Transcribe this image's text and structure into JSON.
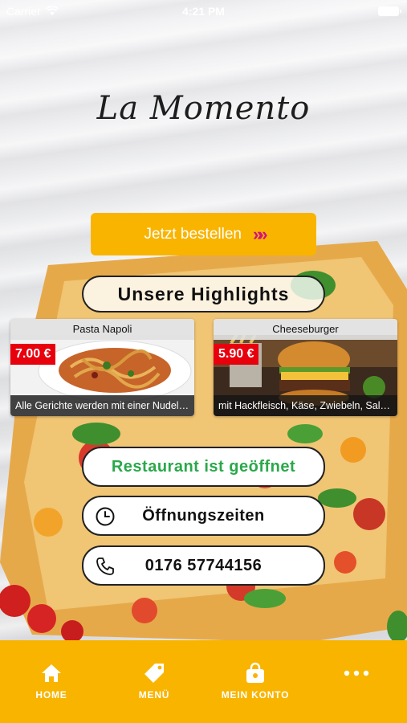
{
  "status_bar": {
    "carrier": "Carrier",
    "time": "4:21 PM"
  },
  "logo": "La Momento",
  "order_button": {
    "label": "Jetzt bestellen",
    "arrows": "»»"
  },
  "highlights": {
    "title": "Unsere Highlights",
    "items": [
      {
        "name": "Pasta Napoli",
        "price": "7.00 €",
        "description": "Alle Gerichte werden mit einer Nudelsor..."
      },
      {
        "name": "Cheeseburger",
        "price": "5.90 €",
        "description": "mit Hackfleisch, Käse, Zwiebeln, Salat, G..."
      }
    ]
  },
  "status_pill": "Restaurant ist geöffnet",
  "hours_pill": "Öffnungszeiten",
  "phone_pill": "0176 57744156",
  "tabbar": {
    "items": [
      {
        "label": "HOME",
        "icon": "home-icon"
      },
      {
        "label": "MENÜ",
        "icon": "tag-icon"
      },
      {
        "label": "MEIN KONTO",
        "icon": "bag-icon"
      },
      {
        "label": "",
        "icon": "more-icon"
      }
    ]
  },
  "colors": {
    "accent": "#f9b400",
    "price": "#e8000d",
    "open": "#2aa84a",
    "arrows": "#d0137c"
  }
}
